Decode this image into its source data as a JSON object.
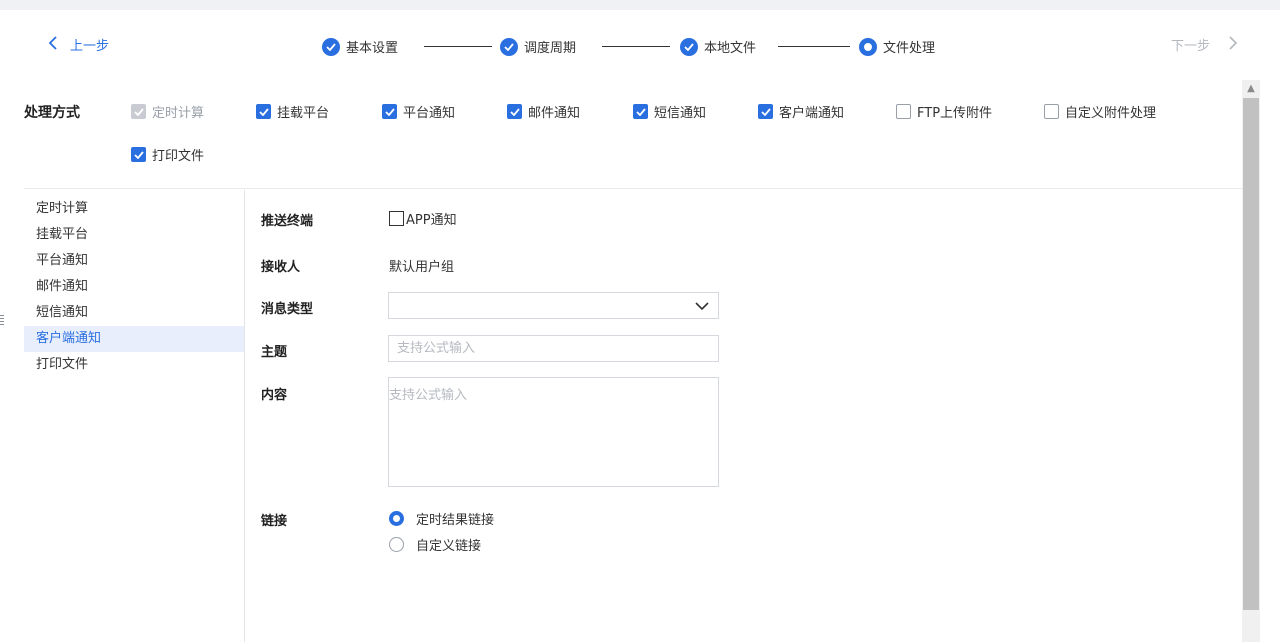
{
  "nav": {
    "prev_label": "上一步",
    "next_label": "下一步",
    "prev_icon": "chevron-left-icon",
    "next_icon": "chevron-right-icon"
  },
  "steps": [
    {
      "label": "基本设置",
      "state": "done"
    },
    {
      "label": "调度周期",
      "state": "done"
    },
    {
      "label": "本地文件",
      "state": "done"
    },
    {
      "label": "文件处理",
      "state": "current"
    }
  ],
  "processing": {
    "label": "处理方式",
    "options": [
      {
        "label": "定时计算",
        "checked": true,
        "disabled": true
      },
      {
        "label": "挂载平台",
        "checked": true,
        "disabled": false
      },
      {
        "label": "平台通知",
        "checked": true,
        "disabled": false
      },
      {
        "label": "邮件通知",
        "checked": true,
        "disabled": false
      },
      {
        "label": "短信通知",
        "checked": true,
        "disabled": false
      },
      {
        "label": "客户端通知",
        "checked": true,
        "disabled": false
      },
      {
        "label": "FTP上传附件",
        "checked": false,
        "disabled": false
      },
      {
        "label": "自定义附件处理",
        "checked": false,
        "disabled": false
      },
      {
        "label": "打印文件",
        "checked": true,
        "disabled": false
      }
    ]
  },
  "sidebar": {
    "items": [
      {
        "label": "定时计算",
        "active": false
      },
      {
        "label": "挂载平台",
        "active": false
      },
      {
        "label": "平台通知",
        "active": false
      },
      {
        "label": "邮件通知",
        "active": false
      },
      {
        "label": "短信通知",
        "active": false
      },
      {
        "label": "客户端通知",
        "active": true
      },
      {
        "label": "打印文件",
        "active": false
      }
    ]
  },
  "form": {
    "push_terminal_label": "推送终端",
    "app_notice_label": "APP通知",
    "app_notice_checked": false,
    "receiver_label": "接收人",
    "receiver_value": "默认用户组",
    "msg_type_label": "消息类型",
    "msg_type_value": "",
    "subject_label": "主题",
    "subject_placeholder": "支持公式输入",
    "content_label": "内容",
    "content_placeholder": "支持公式输入",
    "link_label": "链接",
    "link_options": [
      {
        "label": "定时结果链接",
        "selected": true
      },
      {
        "label": "自定义链接",
        "selected": false
      }
    ]
  },
  "colors": {
    "accent": "#2a6fe0",
    "disabled": "#c8ccd2",
    "active_bg": "#e8eefb"
  }
}
